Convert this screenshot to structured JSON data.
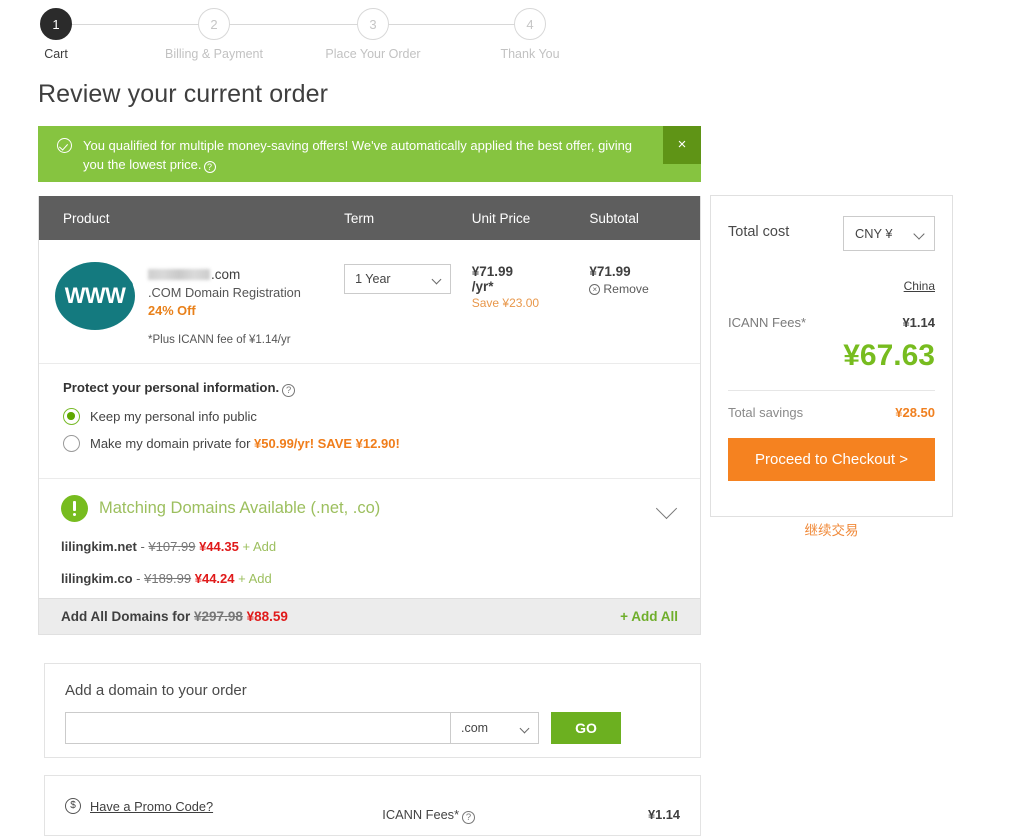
{
  "steps": [
    {
      "num": "1",
      "label": "Cart",
      "active": true
    },
    {
      "num": "2",
      "label": "Billing & Payment",
      "active": false
    },
    {
      "num": "3",
      "label": "Place Your Order",
      "active": false
    },
    {
      "num": "4",
      "label": "Thank You",
      "active": false
    }
  ],
  "page_title": "Review your current order",
  "offer_banner": {
    "text": "You qualified for multiple money-saving offers! We've automatically applied the best offer, giving you the lowest price.",
    "help_glyph": "?",
    "close_glyph": "×",
    "bg_color": "#86c440",
    "close_bg_color": "#5f9416"
  },
  "cart": {
    "columns": {
      "product": "Product",
      "term": "Term",
      "unit_price": "Unit Price",
      "subtotal": "Subtotal"
    },
    "item": {
      "logo_text": "WWW",
      "logo_color": "#147a7f",
      "domain_suffix": ".com",
      "description": ".COM Domain Registration",
      "discount_badge": "24% Off",
      "icann_note": "*Plus ICANN fee of ¥1.14/yr",
      "term_value": "1 Year",
      "unit_price": "¥71.99",
      "unit_price_period": "/yr*",
      "unit_save": "Save ¥23.00",
      "subtotal": "¥71.99",
      "remove_label": "Remove"
    }
  },
  "privacy": {
    "heading": "Protect your personal information.",
    "help_glyph": "?",
    "option_public": "Keep my personal info public",
    "option_private_prefix": "Make my domain private for",
    "option_private_price": "¥50.99/yr! SAVE ¥12.90!",
    "selected": "public"
  },
  "matching_domains": {
    "title": "Matching Domains Available (.net, .co)",
    "rows": [
      {
        "name": "lilingkim.net",
        "dash": "-",
        "old_price": "¥107.99",
        "new_price": "¥44.35",
        "add_label": "+ Add"
      },
      {
        "name": "lilingkim.co",
        "dash": "-",
        "old_price": "¥189.99",
        "new_price": "¥44.24",
        "add_label": "+ Add"
      }
    ],
    "footer_label": "Add All Domains for",
    "footer_old_price": "¥297.98",
    "footer_new_price": "¥88.59",
    "add_all_label": "+ Add All"
  },
  "add_domain": {
    "title": "Add a domain to your order",
    "input_value": "",
    "input_placeholder": "",
    "tld_value": ".com",
    "go_label": "GO"
  },
  "promo": {
    "link_label": "Have a Promo Code?",
    "dollar_glyph": "$",
    "icann_label": "ICANN Fees*",
    "help_glyph": "?",
    "icann_value": "¥1.14"
  },
  "summary": {
    "title": "Total cost",
    "currency_value": "CNY ¥",
    "country_link": "China",
    "icann_label": "ICANN Fees*",
    "icann_value": "¥1.14",
    "grand_total": "¥67.63",
    "grand_total_color": "#77bc1f",
    "savings_label": "Total savings",
    "savings_value": "¥28.50",
    "checkout_label": "Proceed to Checkout >",
    "checkout_color": "#f58220",
    "continue_label": "继续交易"
  }
}
